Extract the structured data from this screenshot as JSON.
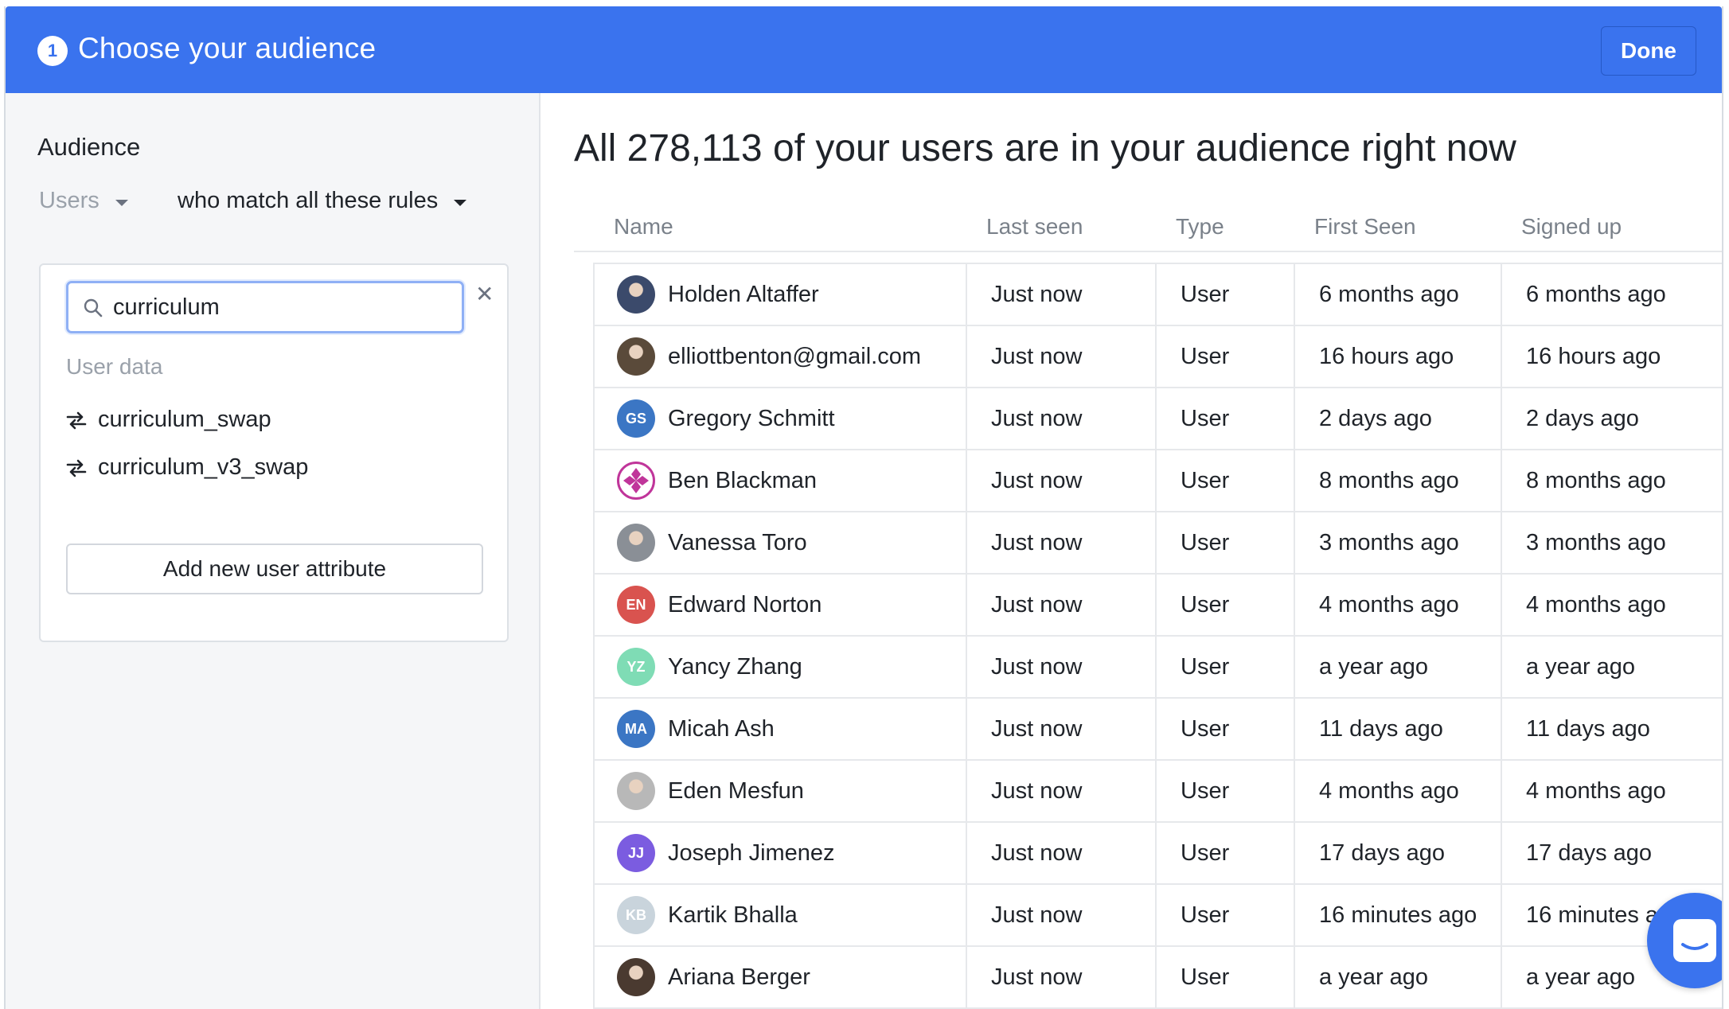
{
  "header": {
    "step_number": "1",
    "title": "Choose your audience",
    "done_label": "Done",
    "accent_color": "#3a73ee"
  },
  "sidebar": {
    "title": "Audience",
    "entity_select": "Users",
    "rule_select": "who match all these rules",
    "search": {
      "value": "curriculum",
      "placeholder": ""
    },
    "section_label": "User data",
    "attributes": [
      {
        "label": "curriculum_swap",
        "icon": "swap-icon"
      },
      {
        "label": "curriculum_v3_swap",
        "icon": "swap-icon"
      }
    ],
    "add_attribute_label": "Add new user attribute"
  },
  "main": {
    "title": "All 278,113 of your users are in your audience right now",
    "columns": [
      "Name",
      "Last seen",
      "Type",
      "First Seen",
      "Signed up"
    ],
    "rows": [
      {
        "name": "Holden Altaffer",
        "avatar": {
          "kind": "photo",
          "color": "#3b4a6b"
        },
        "last_seen": "Just now",
        "type": "User",
        "first_seen": "6 months ago",
        "signed_up": "6 months ago"
      },
      {
        "name": "elliottbenton@gmail.com",
        "avatar": {
          "kind": "photo",
          "color": "#5a4a3a"
        },
        "last_seen": "Just now",
        "type": "User",
        "first_seen": "16 hours ago",
        "signed_up": "16 hours ago"
      },
      {
        "name": "Gregory Schmitt",
        "avatar": {
          "kind": "initials",
          "initials": "GS",
          "color": "#3b76c4"
        },
        "last_seen": "Just now",
        "type": "User",
        "first_seen": "2 days ago",
        "signed_up": "2 days ago"
      },
      {
        "name": "Ben Blackman",
        "avatar": {
          "kind": "pattern",
          "color": "#c0359a"
        },
        "last_seen": "Just now",
        "type": "User",
        "first_seen": "8 months ago",
        "signed_up": "8 months ago"
      },
      {
        "name": "Vanessa Toro",
        "avatar": {
          "kind": "photo",
          "color": "#8a8f96"
        },
        "last_seen": "Just now",
        "type": "User",
        "first_seen": "3 months ago",
        "signed_up": "3 months ago"
      },
      {
        "name": "Edward Norton",
        "avatar": {
          "kind": "initials",
          "initials": "EN",
          "color": "#d9534f"
        },
        "last_seen": "Just now",
        "type": "User",
        "first_seen": "4 months ago",
        "signed_up": "4 months ago"
      },
      {
        "name": "Yancy Zhang",
        "avatar": {
          "kind": "initials",
          "initials": "YZ",
          "color": "#7fdcb5"
        },
        "last_seen": "Just now",
        "type": "User",
        "first_seen": "a year ago",
        "signed_up": "a year ago"
      },
      {
        "name": "Micah Ash",
        "avatar": {
          "kind": "initials",
          "initials": "MA",
          "color": "#3b76c4"
        },
        "last_seen": "Just now",
        "type": "User",
        "first_seen": "11 days ago",
        "signed_up": "11 days ago"
      },
      {
        "name": "Eden Mesfun",
        "avatar": {
          "kind": "photo",
          "color": "#b8b8b8"
        },
        "last_seen": "Just now",
        "type": "User",
        "first_seen": "4 months ago",
        "signed_up": "4 months ago"
      },
      {
        "name": "Joseph Jimenez",
        "avatar": {
          "kind": "initials",
          "initials": "JJ",
          "color": "#7b5ce0"
        },
        "last_seen": "Just now",
        "type": "User",
        "first_seen": "17 days ago",
        "signed_up": "17 days ago"
      },
      {
        "name": "Kartik Bhalla",
        "avatar": {
          "kind": "initials",
          "initials": "KB",
          "color": "#c9d4dc"
        },
        "last_seen": "Just now",
        "type": "User",
        "first_seen": "16 minutes ago",
        "signed_up": "16 minutes ago"
      },
      {
        "name": "Ariana Berger",
        "avatar": {
          "kind": "photo",
          "color": "#4a3a30"
        },
        "last_seen": "Just now",
        "type": "User",
        "first_seen": "a year ago",
        "signed_up": "a year ago"
      }
    ]
  },
  "messenger": {
    "icon": "chat-icon"
  }
}
